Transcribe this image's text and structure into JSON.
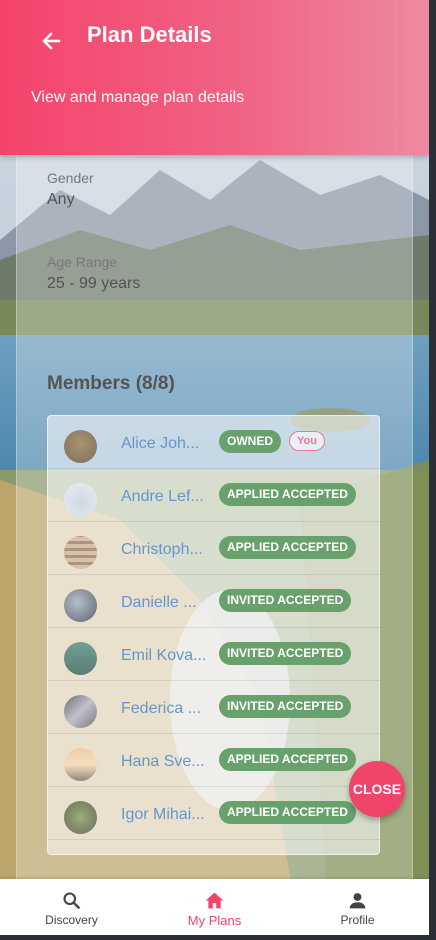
{
  "header": {
    "title": "Plan Details",
    "subtitle": "View and manage plan details"
  },
  "details": [
    {
      "label": "Gender",
      "value": "Any"
    },
    {
      "label": "Age Range",
      "value": "25 - 99 years"
    }
  ],
  "members": {
    "title": "Members (8/8)",
    "you_badge": "You",
    "items": [
      {
        "name": "Alice Joh...",
        "status": "OWNED"
      },
      {
        "name": "Andre Lef...",
        "status": "APPLIED ACCEPTED"
      },
      {
        "name": "Christoph...",
        "status": "APPLIED ACCEPTED"
      },
      {
        "name": "Danielle ...",
        "status": "INVITED ACCEPTED"
      },
      {
        "name": "Emil Kova...",
        "status": "INVITED ACCEPTED"
      },
      {
        "name": "Federica ...",
        "status": "INVITED ACCEPTED"
      },
      {
        "name": "Hana Sve...",
        "status": "APPLIED ACCEPTED"
      },
      {
        "name": "Igor Mihai...",
        "status": "APPLIED ACCEPTED"
      }
    ]
  },
  "close_button": "CLOSE",
  "nav": {
    "items": [
      {
        "label": "Discovery",
        "icon": "search-icon"
      },
      {
        "label": "My Plans",
        "icon": "home-icon"
      },
      {
        "label": "Profile",
        "icon": "person-icon"
      }
    ],
    "active": "My Plans"
  },
  "colors": {
    "accent": "#f0446b",
    "status_green": "#2e7d32",
    "link_blue": "#2b6cb8"
  }
}
